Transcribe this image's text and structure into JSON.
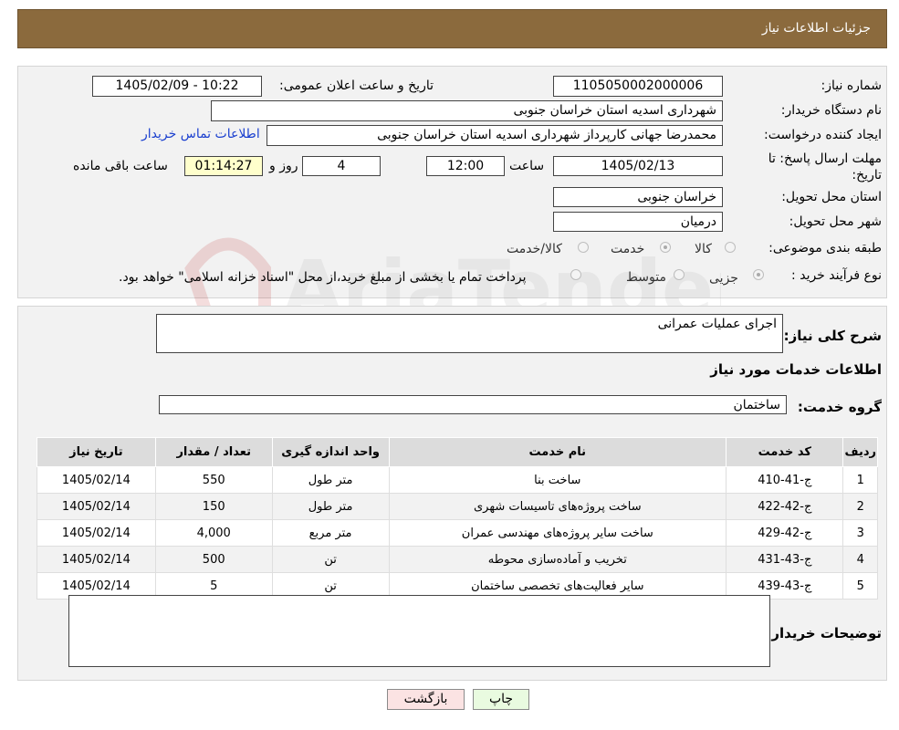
{
  "header": {
    "title": "جزئیات اطلاعات نیاز"
  },
  "info": {
    "need_number_label": "شماره نیاز:",
    "need_number": "1105050002000006",
    "announce_label": "تاریخ و ساعت اعلان عمومی:",
    "announce_value": "1405/02/09 - 10:22",
    "buyer_org_label": "نام دستگاه خریدار:",
    "buyer_org": "شهرداری اسدیه استان خراسان جنوبی",
    "creator_label": "ایجاد کننده درخواست:",
    "creator": "محمدرضا جهانی کارپرداز شهرداری اسدیه استان خراسان جنوبی",
    "contact_link": "اطلاعات تماس خریدار",
    "deadline_label_1": "مهلت ارسال پاسخ: تا",
    "deadline_label_2": "تاریخ:",
    "deadline_date": "1405/02/13",
    "time_label": "ساعت",
    "deadline_time": "12:00",
    "days": "4",
    "days_label": "روز و",
    "remaining": "01:14:27",
    "remaining_label": "ساعت باقی مانده",
    "province_label": "استان محل تحویل:",
    "province": "خراسان جنوبی",
    "city_label": "شهر محل تحویل:",
    "city": "درمیان",
    "category_label": "طبقه بندی موضوعی:",
    "category_options": [
      "کالا",
      "خدمت",
      "کالا/خدمت"
    ],
    "category_selected": "خدمت",
    "process_label": "نوع فرآیند خرید :",
    "process_options": [
      "جزیی",
      "متوسط"
    ],
    "process_note": "پرداخت تمام یا بخشی از مبلغ خرید،از محل \"اسناد خزانه اسلامی\" خواهد بود."
  },
  "details": {
    "summary_label": "شرح کلی نیاز:",
    "summary": "اجرای عملیات عمرانی",
    "services_heading": "اطلاعات خدمات مورد نیاز",
    "group_label": "گروه خدمت:",
    "group": "ساختمان",
    "table": {
      "columns": [
        "ردیف",
        "کد خدمت",
        "نام خدمت",
        "واحد اندازه گیری",
        "تعداد / مقدار",
        "تاریخ نیاز"
      ],
      "rows": [
        [
          "1",
          "ج-41-410",
          "ساخت بنا",
          "متر طول",
          "550",
          "1405/02/14"
        ],
        [
          "2",
          "ج-42-422",
          "ساخت پروژه‌های تاسیسات شهری",
          "متر طول",
          "150",
          "1405/02/14"
        ],
        [
          "3",
          "ج-42-429",
          "ساخت سایر پروژه‌های مهندسی عمران",
          "متر مربع",
          "4,000",
          "1405/02/14"
        ],
        [
          "4",
          "ج-43-431",
          "تخریب و آماده‌سازی محوطه",
          "تن",
          "500",
          "1405/02/14"
        ],
        [
          "5",
          "ج-43-439",
          "سایر فعالیت‌های تخصصی ساختمان",
          "تن",
          "5",
          "1405/02/14"
        ]
      ]
    },
    "buyer_notes_label": "توضیحات خریدار:",
    "buyer_notes": ""
  },
  "buttons": {
    "print": "چاپ",
    "back": "بازگشت"
  },
  "watermark": "AriaTender.neT",
  "colors": {
    "header_bg": "#8b6a3d",
    "link": "#1a3fcf",
    "print_bg": "#e9fbe0",
    "back_bg": "#fbe3e3"
  }
}
